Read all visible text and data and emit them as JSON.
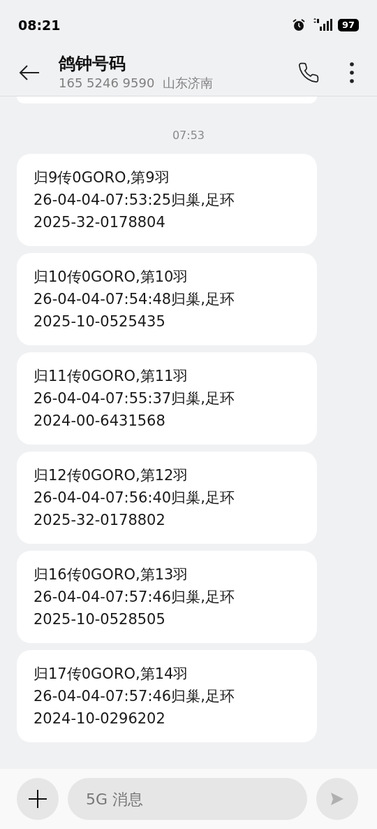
{
  "status_bar": {
    "time": "08:21",
    "battery": "97"
  },
  "header": {
    "title": "鸽钟号码",
    "subtitle": "165 5246 9590  山东济南"
  },
  "timestamp": "07:53",
  "messages": [
    {
      "lines": [
        "归9传0GORO,第9羽",
        "26-04-04-07:53:25归巢,足环",
        "2025-32-0178804"
      ]
    },
    {
      "lines": [
        "归10传0GORO,第10羽",
        "26-04-04-07:54:48归巢,足环",
        "2025-10-0525435"
      ]
    },
    {
      "lines": [
        "归11传0GORO,第11羽",
        "26-04-04-07:55:37归巢,足环",
        "2024-00-6431568"
      ]
    },
    {
      "lines": [
        "归12传0GORO,第12羽",
        "26-04-04-07:56:40归巢,足环",
        "2025-32-0178802"
      ]
    },
    {
      "lines": [
        "归16传0GORO,第13羽",
        "26-04-04-07:57:46归巢,足环",
        "2025-10-0528505"
      ]
    },
    {
      "lines": [
        "归17传0GORO,第14羽",
        "26-04-04-07:57:46归巢,足环",
        "2024-10-0296202"
      ]
    }
  ],
  "composer": {
    "placeholder": "5G 消息"
  }
}
